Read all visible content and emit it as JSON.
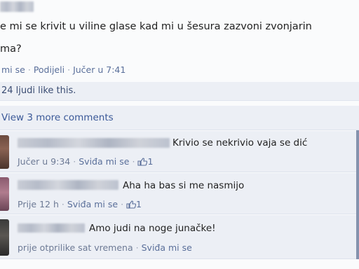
{
  "post": {
    "line1": "e mi se krivit u viline glase kad mi u šesura zazvoni zvonjarin",
    "line2": "ma?",
    "meta": {
      "like_link": "mi se",
      "share_link": "Podijeli",
      "time": "Jučer u 7:41"
    }
  },
  "likes": {
    "text": "24 ljudi like this."
  },
  "view_more": {
    "text": "View 3 more comments"
  },
  "comments": [
    {
      "text": "Krivio se nekrivio vaja se dić",
      "time": "Jučer u 9:34",
      "like_link": "Sviđa mi se",
      "like_count": "1"
    },
    {
      "text": "Aha ha bas si me nasmijo",
      "time": "Prije 12 h",
      "like_link": "Sviđa mi se",
      "like_count": "1"
    },
    {
      "text": "Amo judi na noge junačke!",
      "time": "prije otprilike sat vremena",
      "like_link": "Sviđa mi se"
    }
  ],
  "icons": {
    "like_thumb": "thumbs-up-icon"
  },
  "colors": {
    "link": "#3b5998",
    "meta": "#6d7a95",
    "comment_bg": "#eceff5"
  }
}
